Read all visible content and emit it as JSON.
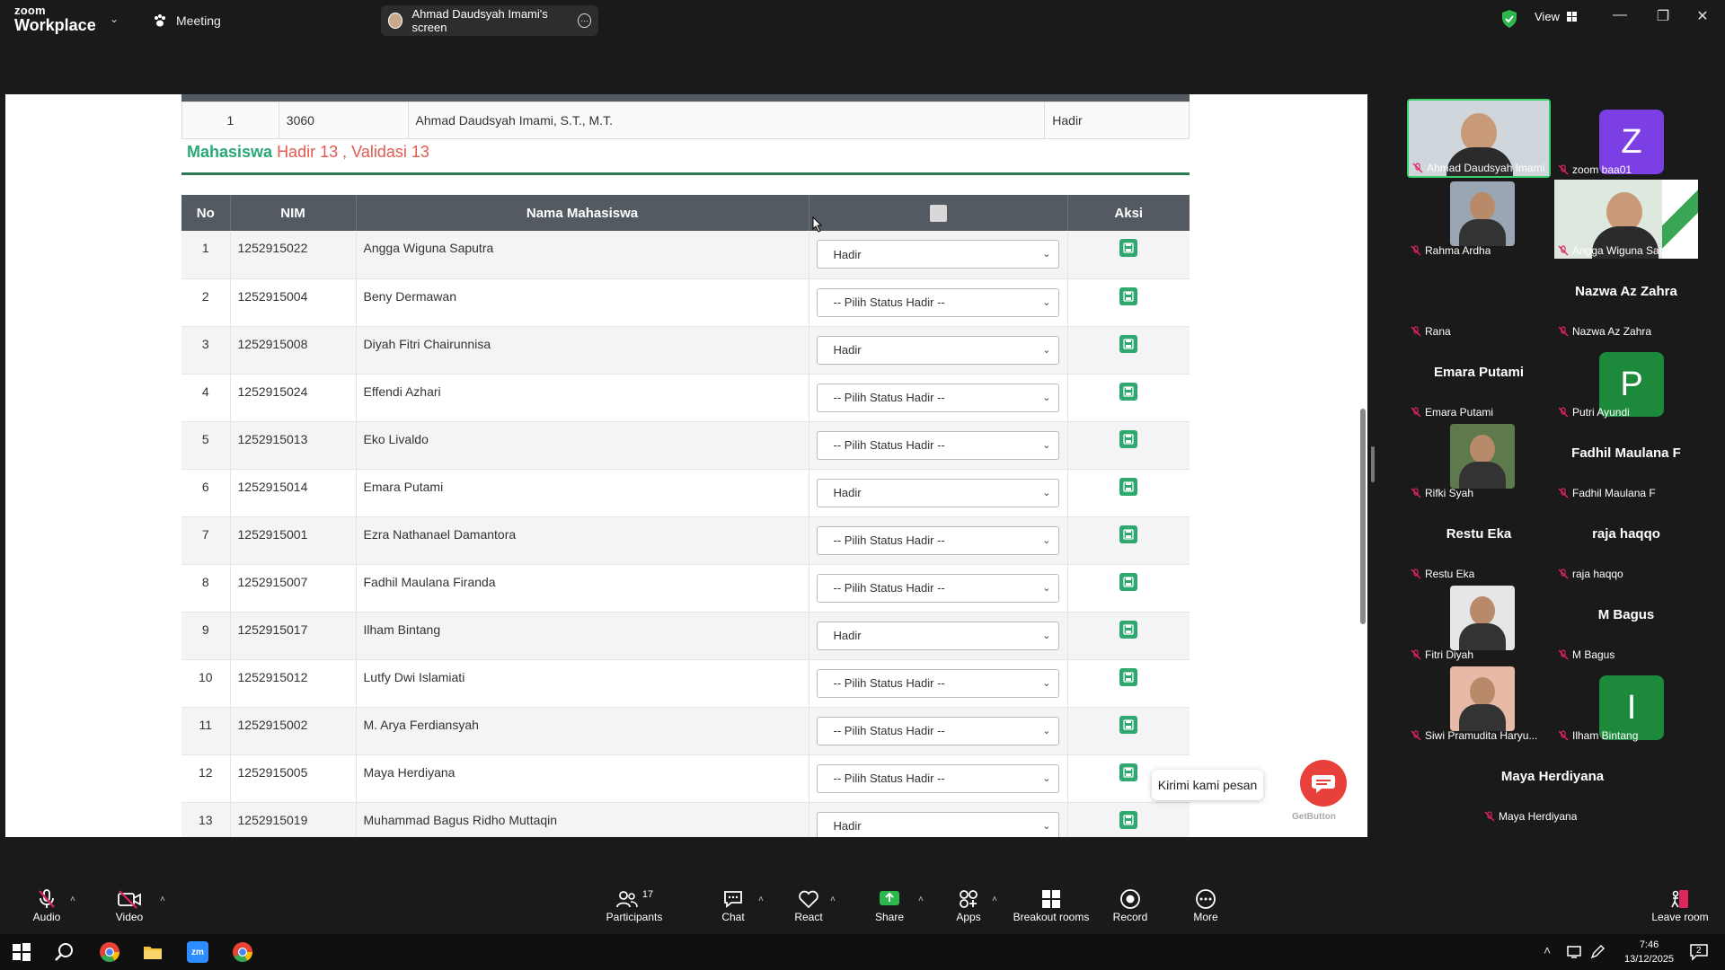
{
  "window": {
    "brand_top": "zoom",
    "brand_bottom": "Workplace",
    "meeting_tab": "Meeting",
    "screen_tab": "Ahmad Daudsyah Imami's screen",
    "view_label": "View"
  },
  "shared_screen": {
    "prev_row": {
      "no": "1",
      "nim": "3060",
      "name": "Ahmad Daudsyah Imami, S.T., M.T.",
      "status": "Hadir"
    },
    "summary": {
      "label": "Mahasiswa",
      "hadir": "Hadir 13",
      "sep": ",",
      "validasi": "Validasi 13"
    },
    "table": {
      "headers": {
        "no": "No",
        "nim": "NIM",
        "name": "Nama Mahasiswa",
        "aksi": "Aksi"
      },
      "rows": [
        {
          "no": "1",
          "nim": "1252915022",
          "name": "Angga Wiguna Saputra",
          "status": "Hadir"
        },
        {
          "no": "2",
          "nim": "1252915004",
          "name": "Beny Dermawan",
          "status": "-- Pilih Status Hadir --"
        },
        {
          "no": "3",
          "nim": "1252915008",
          "name": "Diyah Fitri Chairunnisa",
          "status": "Hadir"
        },
        {
          "no": "4",
          "nim": "1252915024",
          "name": "Effendi Azhari",
          "status": "-- Pilih Status Hadir --"
        },
        {
          "no": "5",
          "nim": "1252915013",
          "name": "Eko Livaldo",
          "status": "-- Pilih Status Hadir --"
        },
        {
          "no": "6",
          "nim": "1252915014",
          "name": "Emara Putami",
          "status": "Hadir"
        },
        {
          "no": "7",
          "nim": "1252915001",
          "name": "Ezra Nathanael Damantora",
          "status": "-- Pilih Status Hadir --"
        },
        {
          "no": "8",
          "nim": "1252915007",
          "name": "Fadhil Maulana Firanda",
          "status": "-- Pilih Status Hadir --"
        },
        {
          "no": "9",
          "nim": "1252915017",
          "name": "Ilham Bintang",
          "status": "Hadir"
        },
        {
          "no": "10",
          "nim": "1252915012",
          "name": "Lutfy Dwi Islamiati",
          "status": "-- Pilih Status Hadir --"
        },
        {
          "no": "11",
          "nim": "1252915002",
          "name": "M. Arya Ferdiansyah",
          "status": "-- Pilih Status Hadir --"
        },
        {
          "no": "12",
          "nim": "1252915005",
          "name": "Maya Herdiyana",
          "status": "-- Pilih Status Hadir --"
        },
        {
          "no": "13",
          "nim": "1252915019",
          "name": "Muhammad Bagus Ridho Muttaqin",
          "status": "Hadir"
        }
      ]
    },
    "chat_widget": "Kirimi kami pesan",
    "getbutton": "GetButton"
  },
  "gallery": {
    "tiles": [
      {
        "name": "Ahmad Daudsyah Imami"
      },
      {
        "name": "zoom baa01",
        "letter": "Z"
      },
      {
        "name": "Rahma Ardha"
      },
      {
        "name": "Angga Wiguna Saputra"
      },
      {
        "name": "Rana"
      },
      {
        "name": "Nazwa Az Zahra",
        "big": "Nazwa Az Zahra"
      },
      {
        "name": "Emara Putami",
        "big": "Emara Putami"
      },
      {
        "name": "Putri Ayundi",
        "letter": "P"
      },
      {
        "name": "Rifki Syah"
      },
      {
        "name": "Fadhil Maulana F",
        "big": "Fadhil Maulana F"
      },
      {
        "name": "Restu Eka",
        "big": "Restu Eka"
      },
      {
        "name": "raja haqqo",
        "big": "raja haqqo"
      },
      {
        "name": "Fitri Diyah"
      },
      {
        "name": "M Bagus",
        "big": "M Bagus"
      },
      {
        "name": "Siwi Pramudita Haryu..."
      },
      {
        "name": "Ilham Bintang",
        "letter": "I"
      },
      {
        "name": "Maya Herdiyana",
        "big": "Maya Herdiyana"
      }
    ],
    "colors": {
      "letter_tile": "#7b3fe4",
      "letter_tile_green": "#1c8a3a",
      "active_border": "#39d06a"
    }
  },
  "toolbar": {
    "audio": "Audio",
    "video": "Video",
    "participants": "Participants",
    "participants_count": "17",
    "chat": "Chat",
    "react": "React",
    "share": "Share",
    "apps": "Apps",
    "breakout": "Breakout rooms",
    "record": "Record",
    "more": "More",
    "leave": "Leave room"
  },
  "taskbar": {
    "time": "7:46",
    "date": "13/12/2025",
    "notif_count": "2"
  }
}
